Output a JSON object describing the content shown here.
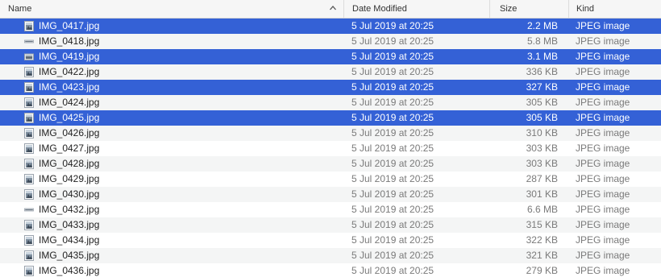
{
  "columns": {
    "name": "Name",
    "date": "Date Modified",
    "size": "Size",
    "kind": "Kind"
  },
  "sort": {
    "column": "name",
    "direction": "ascending",
    "indicator": "chevron-up-icon"
  },
  "colors": {
    "selection": "#3461d6",
    "alternate_row": "#f4f5f5",
    "secondary_text": "#7a7a7a"
  },
  "rows": [
    {
      "name": "IMG_0417.jpg",
      "date": "5 Jul 2019 at 20:25",
      "size": "2.2 MB",
      "kind": "JPEG image",
      "icon": "portrait-photo-icon",
      "selected": true
    },
    {
      "name": "IMG_0418.jpg",
      "date": "5 Jul 2019 at 20:25",
      "size": "5.8 MB",
      "kind": "JPEG image",
      "icon": "panorama-photo-icon",
      "selected": false
    },
    {
      "name": "IMG_0419.jpg",
      "date": "5 Jul 2019 at 20:25",
      "size": "3.1 MB",
      "kind": "JPEG image",
      "icon": "landscape-photo-icon",
      "selected": true
    },
    {
      "name": "IMG_0422.jpg",
      "date": "5 Jul 2019 at 20:25",
      "size": "336 KB",
      "kind": "JPEG image",
      "icon": "portrait-photo-icon",
      "selected": false
    },
    {
      "name": "IMG_0423.jpg",
      "date": "5 Jul 2019 at 20:25",
      "size": "327 KB",
      "kind": "JPEG image",
      "icon": "portrait-photo-icon",
      "selected": true
    },
    {
      "name": "IMG_0424.jpg",
      "date": "5 Jul 2019 at 20:25",
      "size": "305 KB",
      "kind": "JPEG image",
      "icon": "portrait-photo-icon",
      "selected": false
    },
    {
      "name": "IMG_0425.jpg",
      "date": "5 Jul 2019 at 20:25",
      "size": "305 KB",
      "kind": "JPEG image",
      "icon": "portrait-photo-icon",
      "selected": true
    },
    {
      "name": "IMG_0426.jpg",
      "date": "5 Jul 2019 at 20:25",
      "size": "310 KB",
      "kind": "JPEG image",
      "icon": "portrait-photo-icon",
      "selected": false
    },
    {
      "name": "IMG_0427.jpg",
      "date": "5 Jul 2019 at 20:25",
      "size": "303 KB",
      "kind": "JPEG image",
      "icon": "portrait-photo-icon",
      "selected": false
    },
    {
      "name": "IMG_0428.jpg",
      "date": "5 Jul 2019 at 20:25",
      "size": "303 KB",
      "kind": "JPEG image",
      "icon": "portrait-photo-icon",
      "selected": false
    },
    {
      "name": "IMG_0429.jpg",
      "date": "5 Jul 2019 at 20:25",
      "size": "287 KB",
      "kind": "JPEG image",
      "icon": "portrait-photo-icon",
      "selected": false
    },
    {
      "name": "IMG_0430.jpg",
      "date": "5 Jul 2019 at 20:25",
      "size": "301 KB",
      "kind": "JPEG image",
      "icon": "portrait-photo-icon",
      "selected": false
    },
    {
      "name": "IMG_0432.jpg",
      "date": "5 Jul 2019 at 20:25",
      "size": "6.6 MB",
      "kind": "JPEG image",
      "icon": "panorama-photo-icon",
      "selected": false
    },
    {
      "name": "IMG_0433.jpg",
      "date": "5 Jul 2019 at 20:25",
      "size": "315 KB",
      "kind": "JPEG image",
      "icon": "portrait-photo-icon",
      "selected": false
    },
    {
      "name": "IMG_0434.jpg",
      "date": "5 Jul 2019 at 20:25",
      "size": "322 KB",
      "kind": "JPEG image",
      "icon": "portrait-photo-icon",
      "selected": false
    },
    {
      "name": "IMG_0435.jpg",
      "date": "5 Jul 2019 at 20:25",
      "size": "321 KB",
      "kind": "JPEG image",
      "icon": "portrait-photo-icon",
      "selected": false
    },
    {
      "name": "IMG_0436.jpg",
      "date": "5 Jul 2019 at 20:25",
      "size": "279 KB",
      "kind": "JPEG image",
      "icon": "portrait-photo-icon",
      "selected": false
    }
  ]
}
